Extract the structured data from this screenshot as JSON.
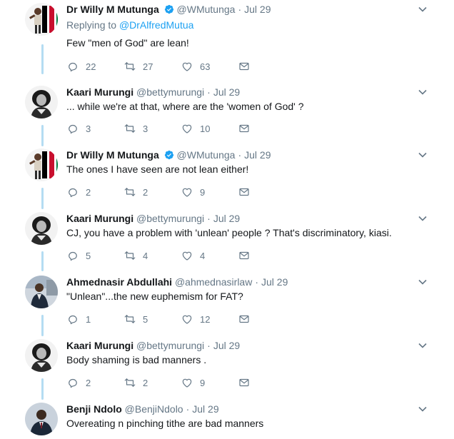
{
  "colors": {
    "link": "#1da1f2",
    "secondary": "#657786",
    "thread": "#b4dcf2",
    "text": "#14171a"
  },
  "icons": {
    "reply": "reply-icon",
    "retweet": "retweet-icon",
    "like": "heart-icon",
    "dm": "envelope-icon",
    "more": "chevron-down-icon",
    "verified": "verified-badge-icon"
  },
  "tweets": [
    {
      "name": "Dr Willy M Mutunga",
      "verified": true,
      "handle": "@WMutunga",
      "sep": "·",
      "time": "Jul 29",
      "reply_prefix": "Replying to",
      "reply_to": "@DrAlfredMutua",
      "text": "Few \"men of God\" are lean!",
      "replies": "22",
      "retweets": "27",
      "likes": "63"
    },
    {
      "name": "Kaari Murungi",
      "verified": false,
      "handle": "@bettymurungi",
      "sep": "·",
      "time": "Jul 29",
      "text": "... while we're at that, where are the 'women of God' ?",
      "replies": "3",
      "retweets": "3",
      "likes": "10"
    },
    {
      "name": "Dr Willy M Mutunga",
      "verified": true,
      "handle": "@WMutunga",
      "sep": "·",
      "time": "Jul 29",
      "text": "The ones I have seen are not lean either!",
      "replies": "2",
      "retweets": "2",
      "likes": "9"
    },
    {
      "name": "Kaari Murungi",
      "verified": false,
      "handle": "@bettymurungi",
      "sep": "·",
      "time": "Jul 29",
      "text": "CJ, you have a problem with 'unlean' people ? That's discriminatory, kiasi.",
      "replies": "5",
      "retweets": "4",
      "likes": "4"
    },
    {
      "name": "Ahmednasir Abdullahi",
      "verified": false,
      "handle": "@ahmednasirlaw",
      "sep": "·",
      "time": "Jul 29",
      "text": "\"Unlean\"...the new euphemism for FAT?",
      "replies": "1",
      "retweets": "5",
      "likes": "12"
    },
    {
      "name": "Kaari Murungi",
      "verified": false,
      "handle": "@bettymurungi",
      "sep": "·",
      "time": "Jul 29",
      "text": "Body shaming is bad manners .",
      "replies": "2",
      "retweets": "2",
      "likes": "9"
    },
    {
      "name": "Benji Ndolo",
      "verified": false,
      "handle": "@BenjiNdolo",
      "sep": "·",
      "time": "Jul 29",
      "text": "Overeating n pinching tithe are bad manners"
    }
  ]
}
